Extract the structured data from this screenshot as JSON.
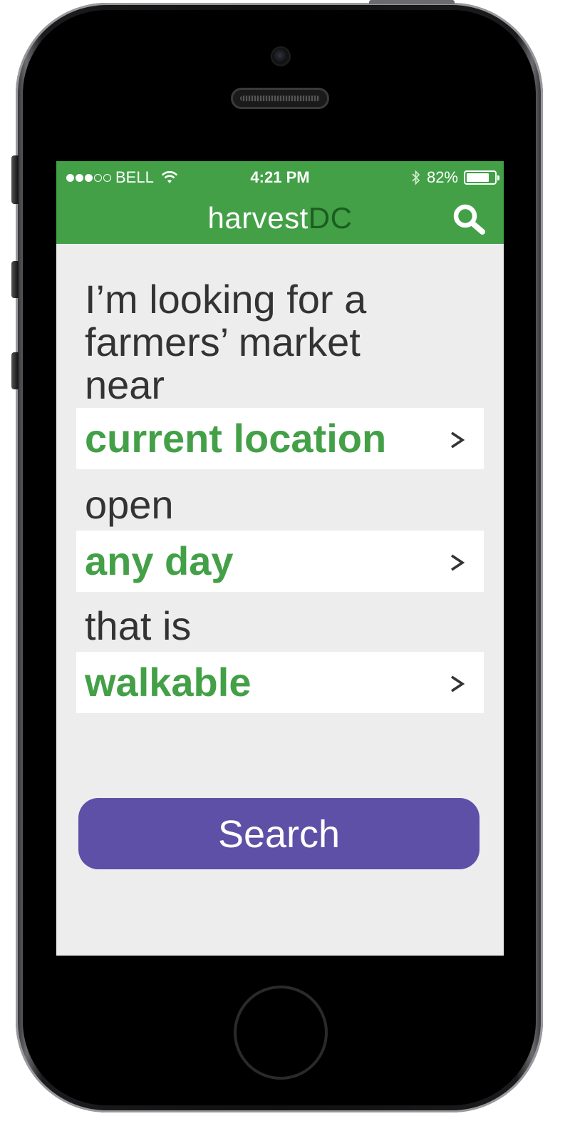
{
  "status_bar": {
    "carrier": "BELL",
    "signal_strength": 3,
    "signal_max": 5,
    "time": "4:21 PM",
    "battery": "82%",
    "battery_level": 0.82
  },
  "header": {
    "title_part1": "harvest",
    "title_part2": "DC",
    "search_icon": "search-icon"
  },
  "form": {
    "prompt_intro": "I’m looking for a farmers’ market near",
    "location_value": "current location",
    "prompt_open": "open",
    "day_value": "any day",
    "prompt_that": "that is",
    "distance_value": "walkable",
    "chevron": ">"
  },
  "actions": {
    "search_label": "Search"
  },
  "colors": {
    "brand_green": "#43a047",
    "dark_green": "#1b5e20",
    "search_purple": "#5e50a6",
    "background": "#ededed"
  }
}
